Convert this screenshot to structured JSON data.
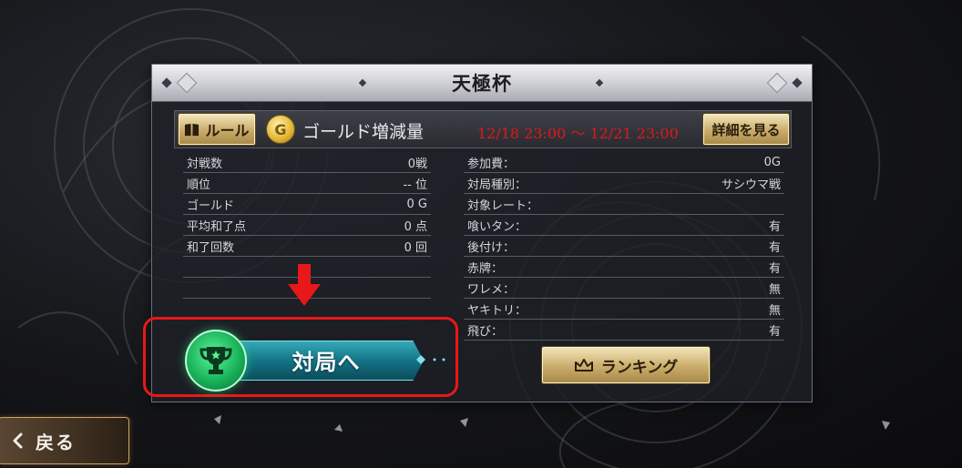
{
  "header": {
    "title": "天極杯"
  },
  "subbar": {
    "rule_label": "ルール",
    "coin_symbol": "G",
    "event_name": "ゴールド増減量",
    "period": "12/18 23:00 ～ 12/21 23:00",
    "detail_label": "詳細を見る"
  },
  "left_stats": [
    {
      "label": "対戦数",
      "value": "0戦"
    },
    {
      "label": "順位",
      "value": "-- 位"
    },
    {
      "label": "ゴールド",
      "value": "0 G"
    },
    {
      "label": "平均和了点",
      "value": "0 点"
    },
    {
      "label": "和了回数",
      "value": "0 回"
    }
  ],
  "right_stats": [
    {
      "label": "参加費：",
      "value": "0G"
    },
    {
      "label": "対局種別：",
      "value": "サシウマ戦"
    },
    {
      "label": "対象レート：",
      "value": ""
    },
    {
      "label": "喰いタン：",
      "value": "有"
    },
    {
      "label": "後付け：",
      "value": "有"
    },
    {
      "label": "赤牌：",
      "value": "有"
    },
    {
      "label": "ワレメ：",
      "value": "無"
    },
    {
      "label": "ヤキトリ：",
      "value": "無"
    },
    {
      "label": "飛び：",
      "value": "有"
    }
  ],
  "buttons": {
    "ranking_label": "ランキング",
    "battle_label": "対局へ",
    "back_label": "戻る"
  },
  "colors": {
    "period": "#e01818",
    "highlight_border": "#e81818",
    "arrow": "#e81818"
  },
  "icons": {
    "rule": "book-icon",
    "coin": "gold-coin-icon",
    "ranking": "crown-icon",
    "battle": "trophy-icon",
    "back": "chevron-left-icon",
    "pointer": "arrow-down-icon"
  }
}
